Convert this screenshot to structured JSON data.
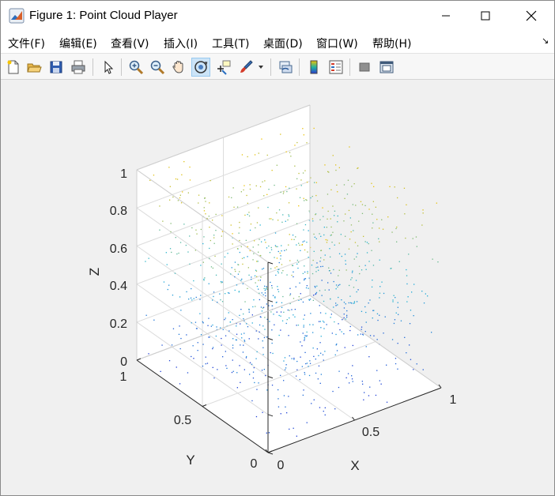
{
  "window": {
    "title": "Figure 1: Point Cloud Player"
  },
  "menubar": {
    "items": [
      {
        "label": "文件(F)"
      },
      {
        "label": "编辑(E)"
      },
      {
        "label": "查看(V)"
      },
      {
        "label": "插入(I)"
      },
      {
        "label": "工具(T)"
      },
      {
        "label": "桌面(D)"
      },
      {
        "label": "窗口(W)"
      },
      {
        "label": "帮助(H)"
      }
    ],
    "overflow_icon": "corner-arrow-icon"
  },
  "toolbar": {
    "buttons": [
      {
        "name": "new-figure",
        "icon": "new-document-icon"
      },
      {
        "name": "open-file",
        "icon": "folder-open-icon"
      },
      {
        "name": "save-figure",
        "icon": "save-disk-icon"
      },
      {
        "name": "print-figure",
        "icon": "printer-icon"
      },
      {
        "name": "edit-plot",
        "icon": "pointer-arrow-icon"
      },
      {
        "name": "zoom-in",
        "icon": "zoom-in-icon"
      },
      {
        "name": "zoom-out",
        "icon": "zoom-out-icon"
      },
      {
        "name": "pan",
        "icon": "hand-icon"
      },
      {
        "name": "rotate-3d",
        "icon": "rotate-3d-icon",
        "active": true
      },
      {
        "name": "data-cursor",
        "icon": "data-cursor-icon"
      },
      {
        "name": "brush",
        "icon": "brush-icon"
      },
      {
        "name": "link-plot",
        "icon": "link-plot-icon"
      },
      {
        "name": "insert-colorbar",
        "icon": "colorbar-icon"
      },
      {
        "name": "insert-legend",
        "icon": "legend-icon"
      },
      {
        "name": "hide-plot-tools",
        "icon": "hide-tools-icon"
      },
      {
        "name": "show-plot-tools",
        "icon": "show-tools-icon"
      }
    ]
  },
  "chart_data": {
    "type": "scatter",
    "projection": "3d",
    "title": "",
    "xlabel": "X",
    "ylabel": "Y",
    "zlabel": "Z",
    "xlim": [
      0,
      1
    ],
    "ylim": [
      0,
      1
    ],
    "zlim": [
      0,
      1
    ],
    "x_ticks": [
      "0",
      "0.5",
      "1"
    ],
    "y_ticks": [
      "0",
      "0.5",
      "1"
    ],
    "z_ticks": [
      "0",
      "0.2",
      "0.4",
      "0.6",
      "0.8",
      "1"
    ],
    "grid": true,
    "colormap": "parula (colored by Z)",
    "color_low": "#1f3bd6",
    "color_mid": "#20b4d8",
    "color_high": "#f2c200",
    "point_count": 1000,
    "distribution": "uniform random in unit cube",
    "seed": 7
  }
}
